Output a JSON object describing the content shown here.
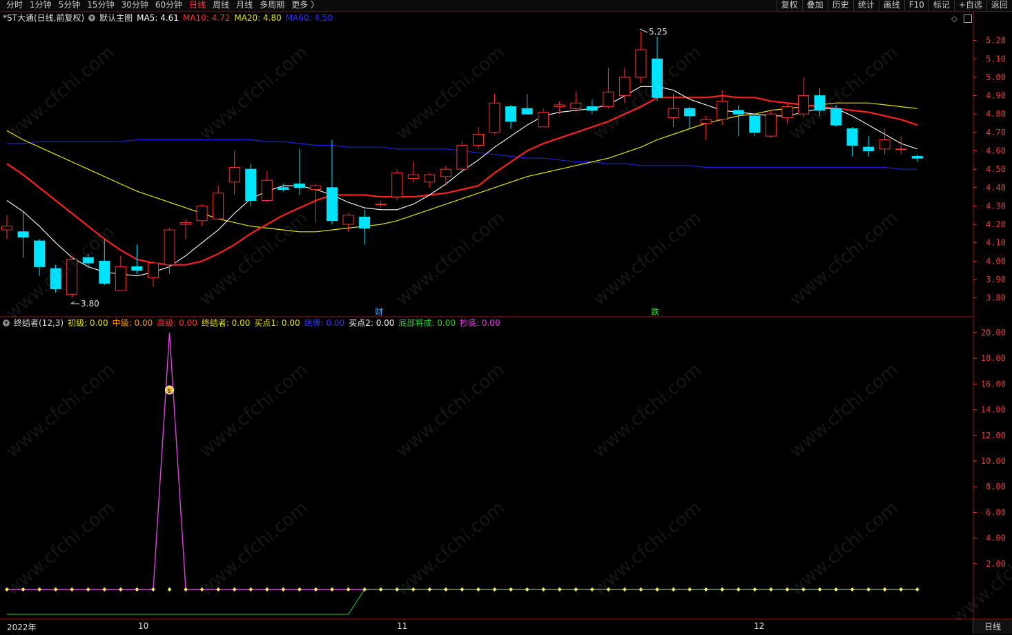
{
  "toolbar": {
    "tabs": [
      {
        "label": "分时",
        "active": false
      },
      {
        "label": "1分钟",
        "active": false
      },
      {
        "label": "5分钟",
        "active": false
      },
      {
        "label": "15分钟",
        "active": false
      },
      {
        "label": "30分钟",
        "active": false
      },
      {
        "label": "60分钟",
        "active": false
      },
      {
        "label": "日线",
        "active": true
      },
      {
        "label": "周线",
        "active": false
      },
      {
        "label": "月线",
        "active": false
      },
      {
        "label": "多周期",
        "active": false
      },
      {
        "label": "更多 〉",
        "active": false
      }
    ],
    "tools": [
      "复权",
      "叠加",
      "历史",
      "统计",
      "画线",
      "F10",
      "标记",
      "+自选",
      "返回"
    ]
  },
  "main_legend": {
    "stock": "*ST大通(日线,前复权)",
    "template": "默认主图",
    "ma5": "MA5: 4.61",
    "ma10": "MA10: 4.72",
    "ma20": "MA20: 4.80",
    "ma60": "MA60: 4.50"
  },
  "sub_legend": {
    "name": "终结者(12,3)",
    "items": [
      {
        "text": "初级: 0.00",
        "color": "#e6e600"
      },
      {
        "text": "中级: 0.00",
        "color": "#ff9900"
      },
      {
        "text": "高级: 0.00",
        "color": "#ff3333"
      },
      {
        "text": "终结者: 0.00",
        "color": "#e6e600"
      },
      {
        "text": "买点1: 0.00",
        "color": "#e6e600"
      },
      {
        "text": "绝牌: 0.00",
        "color": "#3333ff"
      },
      {
        "text": "买点2: 0.00",
        "color": "#ffffff"
      },
      {
        "text": "底部将成: 0.00",
        "color": "#33cc33"
      },
      {
        "text": "抄底: 0.00",
        "color": "#ff33ff"
      }
    ]
  },
  "annotations": {
    "high_label": "5.25",
    "low_label": "3.80",
    "cai": "财",
    "die": "跌"
  },
  "x_axis": {
    "labels": [
      "2022年",
      "10",
      "11",
      "12"
    ]
  },
  "corner_button": "日线",
  "watermark": "www.cfchi.com",
  "colors": {
    "up": "#ff3030",
    "down": "#00e5ff",
    "ma5": "#ffffff",
    "ma10": "#ff2020",
    "ma20": "#e6e600",
    "ma60": "#2020e0",
    "axis": "#e83c3c"
  },
  "chart_data": [
    {
      "type": "candlestick",
      "ylim": [
        3.75,
        5.27
      ],
      "y_ticks": [
        "5.20",
        "5.10",
        "5.00",
        "4.90",
        "4.80",
        "4.70",
        "4.60",
        "4.50",
        "4.40",
        "4.30",
        "4.20",
        "4.10",
        "4.00",
        "3.90",
        "3.80"
      ],
      "candles": [
        {
          "o": 4.17,
          "c": 4.19,
          "h": 4.25,
          "l": 4.12
        },
        {
          "o": 4.16,
          "c": 4.13,
          "h": 4.27,
          "l": 4.02
        },
        {
          "o": 4.11,
          "c": 3.97,
          "h": 4.12,
          "l": 3.92
        },
        {
          "o": 3.96,
          "c": 3.85,
          "h": 3.98,
          "l": 3.83
        },
        {
          "o": 3.82,
          "c": 4.01,
          "h": 4.03,
          "l": 3.8
        },
        {
          "o": 4.02,
          "c": 3.99,
          "h": 4.04,
          "l": 3.96
        },
        {
          "o": 4.0,
          "c": 3.88,
          "h": 4.12,
          "l": 3.87
        },
        {
          "o": 3.84,
          "c": 3.97,
          "h": 4.03,
          "l": 3.84
        },
        {
          "o": 3.97,
          "c": 3.95,
          "h": 4.09,
          "l": 3.93
        },
        {
          "o": 3.91,
          "c": 3.99,
          "h": 4.0,
          "l": 3.86
        },
        {
          "o": 3.98,
          "c": 4.17,
          "h": 4.18,
          "l": 3.93
        },
        {
          "o": 4.2,
          "c": 4.21,
          "h": 4.23,
          "l": 4.12
        },
        {
          "o": 4.22,
          "c": 4.3,
          "h": 4.31,
          "l": 4.19
        },
        {
          "o": 4.23,
          "c": 4.37,
          "h": 4.41,
          "l": 4.23
        },
        {
          "o": 4.43,
          "c": 4.51,
          "h": 4.6,
          "l": 4.36
        },
        {
          "o": 4.5,
          "c": 4.33,
          "h": 4.53,
          "l": 4.3
        },
        {
          "o": 4.33,
          "c": 4.44,
          "h": 4.49,
          "l": 4.32
        },
        {
          "o": 4.4,
          "c": 4.39,
          "h": 4.42,
          "l": 4.38
        },
        {
          "o": 4.42,
          "c": 4.4,
          "h": 4.61,
          "l": 4.36
        },
        {
          "o": 4.39,
          "c": 4.41,
          "h": 4.42,
          "l": 4.21
        },
        {
          "o": 4.4,
          "c": 4.22,
          "h": 4.66,
          "l": 4.2
        },
        {
          "o": 4.2,
          "c": 4.25,
          "h": 4.26,
          "l": 4.16
        },
        {
          "o": 4.24,
          "c": 4.18,
          "h": 4.28,
          "l": 4.09
        },
        {
          "o": 4.31,
          "c": 4.31,
          "h": 4.33,
          "l": 4.29
        },
        {
          "o": 4.35,
          "c": 4.48,
          "h": 4.5,
          "l": 4.33
        },
        {
          "o": 4.45,
          "c": 4.47,
          "h": 4.54,
          "l": 4.43
        },
        {
          "o": 4.43,
          "c": 4.47,
          "h": 4.48,
          "l": 4.4
        },
        {
          "o": 4.46,
          "c": 4.5,
          "h": 4.52,
          "l": 4.41
        },
        {
          "o": 4.5,
          "c": 4.63,
          "h": 4.65,
          "l": 4.48
        },
        {
          "o": 4.63,
          "c": 4.69,
          "h": 4.73,
          "l": 4.61
        },
        {
          "o": 4.7,
          "c": 4.86,
          "h": 4.91,
          "l": 4.69
        },
        {
          "o": 4.84,
          "c": 4.76,
          "h": 4.85,
          "l": 4.72
        },
        {
          "o": 4.83,
          "c": 4.8,
          "h": 4.91,
          "l": 4.8
        },
        {
          "o": 4.73,
          "c": 4.81,
          "h": 4.83,
          "l": 4.73
        },
        {
          "o": 4.84,
          "c": 4.85,
          "h": 4.87,
          "l": 4.8
        },
        {
          "o": 4.83,
          "c": 4.86,
          "h": 4.92,
          "l": 4.81
        },
        {
          "o": 4.84,
          "c": 4.82,
          "h": 4.88,
          "l": 4.8
        },
        {
          "o": 4.84,
          "c": 4.92,
          "h": 5.05,
          "l": 4.83
        },
        {
          "o": 4.9,
          "c": 5.0,
          "h": 5.05,
          "l": 4.86
        },
        {
          "o": 5.0,
          "c": 5.15,
          "h": 5.25,
          "l": 4.97
        },
        {
          "o": 5.1,
          "c": 4.89,
          "h": 5.22,
          "l": 4.87
        },
        {
          "o": 4.78,
          "c": 4.83,
          "h": 4.91,
          "l": 4.73
        },
        {
          "o": 4.83,
          "c": 4.79,
          "h": 4.84,
          "l": 4.72
        },
        {
          "o": 4.75,
          "c": 4.77,
          "h": 4.79,
          "l": 4.66
        },
        {
          "o": 4.77,
          "c": 4.87,
          "h": 4.93,
          "l": 4.74
        },
        {
          "o": 4.82,
          "c": 4.8,
          "h": 4.85,
          "l": 4.68
        },
        {
          "o": 4.79,
          "c": 4.7,
          "h": 4.8,
          "l": 4.68
        },
        {
          "o": 4.68,
          "c": 4.8,
          "h": 4.82,
          "l": 4.67
        },
        {
          "o": 4.78,
          "c": 4.84,
          "h": 4.86,
          "l": 4.75
        },
        {
          "o": 4.8,
          "c": 4.9,
          "h": 5.0,
          "l": 4.78
        },
        {
          "o": 4.9,
          "c": 4.82,
          "h": 4.94,
          "l": 4.79
        },
        {
          "o": 4.83,
          "c": 4.74,
          "h": 4.85,
          "l": 4.73
        },
        {
          "o": 4.72,
          "c": 4.63,
          "h": 4.73,
          "l": 4.57
        },
        {
          "o": 4.62,
          "c": 4.6,
          "h": 4.68,
          "l": 4.57
        },
        {
          "o": 4.61,
          "c": 4.66,
          "h": 4.72,
          "l": 4.58
        },
        {
          "o": 4.61,
          "c": 4.61,
          "h": 4.68,
          "l": 4.58
        },
        {
          "o": 4.57,
          "c": 4.56,
          "h": 4.58,
          "l": 4.54
        }
      ],
      "ma5": [
        4.33,
        4.27,
        4.19,
        4.1,
        4.02,
        3.97,
        3.94,
        3.93,
        3.92,
        3.94,
        3.97,
        4.03,
        4.1,
        4.17,
        4.26,
        4.34,
        4.38,
        4.41,
        4.41,
        4.39,
        4.36,
        4.32,
        4.29,
        4.28,
        4.28,
        4.31,
        4.36,
        4.42,
        4.49,
        4.55,
        4.62,
        4.68,
        4.74,
        4.79,
        4.81,
        4.82,
        4.83,
        4.85,
        4.9,
        4.95,
        4.95,
        4.93,
        4.88,
        4.85,
        4.82,
        4.81,
        4.8,
        4.79,
        4.79,
        4.81,
        4.83,
        4.83,
        4.79,
        4.74,
        4.69,
        4.64,
        4.61
      ],
      "ma10": [
        4.53,
        4.47,
        4.4,
        4.33,
        4.26,
        4.19,
        4.12,
        4.06,
        4.01,
        3.99,
        3.98,
        3.98,
        4.0,
        4.04,
        4.09,
        4.15,
        4.2,
        4.25,
        4.29,
        4.33,
        4.36,
        4.36,
        4.36,
        4.35,
        4.35,
        4.35,
        4.36,
        4.37,
        4.39,
        4.41,
        4.48,
        4.54,
        4.6,
        4.64,
        4.67,
        4.7,
        4.73,
        4.76,
        4.8,
        4.84,
        4.89,
        4.89,
        4.89,
        4.89,
        4.9,
        4.89,
        4.89,
        4.87,
        4.86,
        4.85,
        4.84,
        4.83,
        4.82,
        4.81,
        4.79,
        4.77,
        4.74
      ],
      "ma20": [
        4.71,
        4.66,
        4.62,
        4.58,
        4.54,
        4.5,
        4.46,
        4.42,
        4.38,
        4.35,
        4.32,
        4.29,
        4.26,
        4.23,
        4.21,
        4.19,
        4.18,
        4.17,
        4.16,
        4.16,
        4.17,
        4.18,
        4.19,
        4.2,
        4.22,
        4.25,
        4.28,
        4.31,
        4.34,
        4.37,
        4.4,
        4.43,
        4.46,
        4.48,
        4.5,
        4.52,
        4.54,
        4.56,
        4.59,
        4.62,
        4.66,
        4.69,
        4.72,
        4.75,
        4.77,
        4.79,
        4.8,
        4.82,
        4.83,
        4.84,
        4.85,
        4.86,
        4.86,
        4.86,
        4.85,
        4.84,
        4.83
      ],
      "ma60": [
        4.64,
        4.64,
        4.65,
        4.65,
        4.65,
        4.65,
        4.65,
        4.65,
        4.66,
        4.66,
        4.66,
        4.66,
        4.66,
        4.66,
        4.66,
        4.66,
        4.65,
        4.65,
        4.64,
        4.63,
        4.63,
        4.62,
        4.62,
        4.62,
        4.61,
        4.61,
        4.61,
        4.61,
        4.6,
        4.59,
        4.58,
        4.57,
        4.56,
        4.56,
        4.55,
        4.54,
        4.54,
        4.53,
        4.53,
        4.52,
        4.52,
        4.52,
        4.52,
        4.51,
        4.51,
        4.51,
        4.51,
        4.51,
        4.51,
        4.51,
        4.51,
        4.51,
        4.51,
        4.51,
        4.51,
        4.5,
        4.5
      ]
    },
    {
      "type": "line",
      "ylim": [
        0,
        21
      ],
      "y_ticks": [
        "20.00",
        "18.00",
        "16.00",
        "14.00",
        "12.00",
        "10.00",
        "8.00",
        "6.00",
        "4.00",
        "2.00"
      ],
      "series": [
        {
          "name": "抄底",
          "values": [
            0,
            0,
            0,
            0,
            0,
            0,
            0,
            0,
            0,
            0,
            20,
            0,
            0,
            0,
            0,
            0,
            0,
            0,
            0,
            0,
            0,
            0,
            0,
            0,
            0,
            0,
            0,
            0,
            0,
            0,
            0,
            0,
            0,
            0,
            0,
            0,
            0,
            0,
            0,
            0,
            0,
            0,
            0,
            0,
            0,
            0,
            0,
            0,
            0,
            0,
            0,
            0,
            0,
            0,
            0,
            0,
            0
          ]
        },
        {
          "name": "底部将成",
          "values": [
            -2,
            -2,
            -2,
            -2,
            -2,
            -2,
            -2,
            -2,
            -2,
            -2,
            -2,
            -2,
            -2,
            -2,
            -2,
            -2,
            -2,
            -2,
            -2,
            -2,
            -2,
            -2,
            0,
            0,
            0,
            0,
            0,
            0,
            0,
            0,
            0,
            0,
            0,
            0,
            0,
            0,
            0,
            0,
            0,
            0,
            0,
            0,
            0,
            0,
            0,
            0,
            0,
            0,
            0,
            0,
            0,
            0,
            0,
            0,
            0,
            0,
            0
          ]
        }
      ]
    }
  ]
}
